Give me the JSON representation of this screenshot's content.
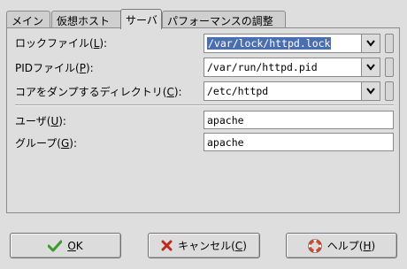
{
  "tabs": [
    {
      "label": "メイン"
    },
    {
      "label": "仮想ホスト"
    },
    {
      "label": "サーバ"
    },
    {
      "label": "パフォーマンスの調整"
    }
  ],
  "form": {
    "lock_file": {
      "label_pre": "ロックファイル(",
      "mnemonic": "L",
      "label_post": "):",
      "value": "/var/lock/httpd.lock"
    },
    "pid_file": {
      "label_pre": "PIDファイル(",
      "mnemonic": "P",
      "label_post": "):",
      "value": "/var/run/httpd.pid"
    },
    "core_dump_dir": {
      "label_pre": "コアをダンプするディレクトリ(",
      "mnemonic": "C",
      "label_post": "):",
      "value": "/etc/httpd"
    },
    "user": {
      "label_pre": "ユーザ(",
      "mnemonic": "U",
      "label_post": "):",
      "value": "apache"
    },
    "group": {
      "label_pre": "グループ(",
      "mnemonic": "G",
      "label_post": "):",
      "value": "apache"
    }
  },
  "buttons": {
    "ok": {
      "label_pre": "",
      "mnemonic": "O",
      "label_post": "K"
    },
    "cancel": {
      "label_pre": "キャンセル(",
      "mnemonic": "C",
      "label_post": ")"
    },
    "help": {
      "label_pre": "ヘルプ(",
      "mnemonic": "H",
      "label_post": ")"
    }
  },
  "colors": {
    "selection": "#4a6fb0",
    "ok_check": "#3a9a2a",
    "cancel_x": "#c0281e",
    "help_ring": "#d24a2a"
  }
}
